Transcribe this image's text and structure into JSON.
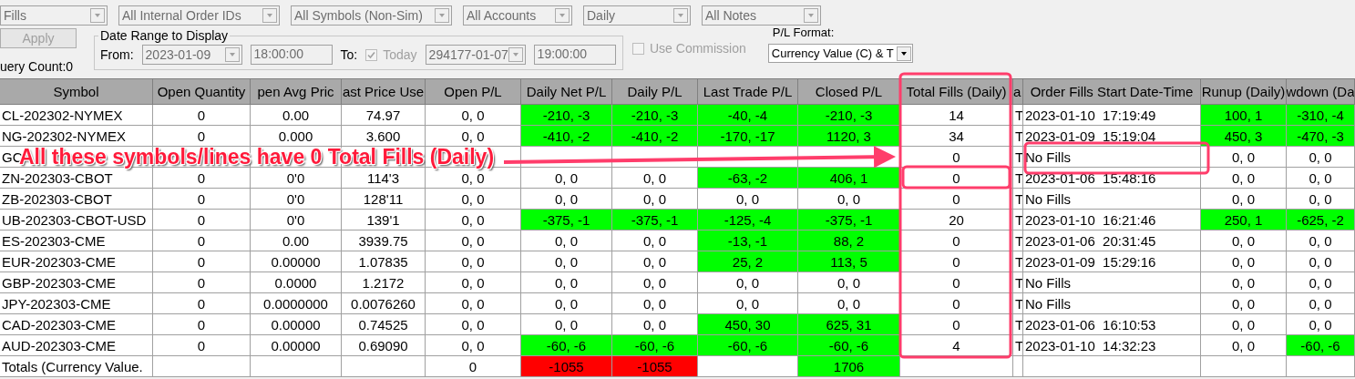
{
  "filters": [
    {
      "value": "Fills",
      "disabled": true
    },
    {
      "value": "All Internal Order IDs",
      "disabled": true
    },
    {
      "value": "All Symbols (Non-Sim)",
      "disabled": true
    },
    {
      "value": "All Accounts",
      "disabled": true
    },
    {
      "value": "Daily",
      "disabled": true
    },
    {
      "value": "All Notes",
      "disabled": true
    }
  ],
  "apply_button": {
    "label": "Apply",
    "disabled": true
  },
  "query_count": "uery Count:0",
  "date_range": {
    "title": "Date Range to Display",
    "from_label": "From:",
    "from_date": "2023-01-09",
    "from_time": "18:00:00",
    "to_label": "To:",
    "today": {
      "label": "Today",
      "checked": true,
      "disabled": true
    },
    "to_date": "294177-01-07",
    "to_time": "19:00:00"
  },
  "use_commission": {
    "label": "Use Commission",
    "checked": false,
    "disabled": true
  },
  "pl_format": {
    "label": "P/L Format:",
    "value": "Currency Value (C) & T"
  },
  "table": {
    "columns": [
      "Symbol",
      "Open Quantity",
      "pen Avg Pric",
      "ast Price Use",
      "Open P/L",
      "Daily Net P/L",
      "Daily P/L",
      "Last Trade P/L",
      "Closed P/L",
      "Total Fills (Daily)",
      "a",
      "Order Fills Start Date-Time",
      "Runup (Daily)",
      "wdown (Da"
    ],
    "rows": [
      [
        {
          "text": "CL-202302-NYMEX"
        },
        {
          "text": "0"
        },
        {
          "text": "0.00"
        },
        {
          "text": "74.97"
        },
        {
          "text": "0, 0"
        },
        {
          "text": "-210, -3",
          "color": "#00ff00"
        },
        {
          "text": "-210, -3",
          "color": "#00ff00"
        },
        {
          "text": "-40, -4",
          "color": "#00ff00"
        },
        {
          "text": "-210, -3",
          "color": "#00ff00"
        },
        {
          "text": "14"
        },
        {
          "text": "T"
        },
        {
          "text": "2023-01-10  17:19:49"
        },
        {
          "text": "100, 1",
          "color": "#00ff00"
        },
        {
          "text": "-310, -4",
          "color": "#00ff00"
        }
      ],
      [
        {
          "text": "NG-202302-NYMEX"
        },
        {
          "text": "0"
        },
        {
          "text": "0.000"
        },
        {
          "text": "3.600"
        },
        {
          "text": "0, 0"
        },
        {
          "text": "-410, -2",
          "color": "#00ff00"
        },
        {
          "text": "-410, -2",
          "color": "#00ff00"
        },
        {
          "text": "-170, -17",
          "color": "#00ff00"
        },
        {
          "text": "1120, 3",
          "color": "#00ff00"
        },
        {
          "text": "34"
        },
        {
          "text": "T"
        },
        {
          "text": "2023-01-09  15:19:04"
        },
        {
          "text": "450, 3",
          "color": "#00ff00"
        },
        {
          "text": "-470, -3",
          "color": "#00ff00"
        }
      ],
      [
        {
          "text": "GC"
        },
        null,
        null,
        null,
        null,
        null,
        null,
        null,
        null,
        {
          "text": "0"
        },
        {
          "text": "T"
        },
        {
          "text": "No Fills"
        },
        {
          "text": "0, 0"
        },
        {
          "text": "0, 0"
        }
      ],
      [
        {
          "text": "ZN-202303-CBOT"
        },
        {
          "text": "0"
        },
        {
          "text": "0'0"
        },
        {
          "text": "114'3"
        },
        {
          "text": "0, 0"
        },
        {
          "text": "0, 0"
        },
        {
          "text": "0, 0"
        },
        {
          "text": "-63, -2",
          "color": "#00ff00"
        },
        {
          "text": "406, 1",
          "color": "#00ff00"
        },
        {
          "text": "0"
        },
        {
          "text": "T"
        },
        {
          "text": "2023-01-06  15:48:16"
        },
        {
          "text": "0, 0"
        },
        {
          "text": "0, 0"
        }
      ],
      [
        {
          "text": "ZB-202303-CBOT"
        },
        {
          "text": "0"
        },
        {
          "text": "0'0"
        },
        {
          "text": "128'11"
        },
        {
          "text": "0, 0"
        },
        {
          "text": "0, 0"
        },
        {
          "text": "0, 0"
        },
        {
          "text": "0, 0"
        },
        {
          "text": "0, 0"
        },
        {
          "text": "0"
        },
        {
          "text": "T"
        },
        {
          "text": "No Fills"
        },
        {
          "text": "0, 0"
        },
        {
          "text": "0, 0"
        }
      ],
      [
        {
          "text": "UB-202303-CBOT-USD"
        },
        {
          "text": "0"
        },
        {
          "text": "0'0"
        },
        {
          "text": "139'1"
        },
        {
          "text": "0, 0"
        },
        {
          "text": "-375, -1",
          "color": "#00ff00"
        },
        {
          "text": "-375, -1",
          "color": "#00ff00"
        },
        {
          "text": "-125, -4",
          "color": "#00ff00"
        },
        {
          "text": "-375, -1",
          "color": "#00ff00"
        },
        {
          "text": "20"
        },
        {
          "text": "T"
        },
        {
          "text": "2023-01-10  16:21:46"
        },
        {
          "text": "250, 1",
          "color": "#00ff00"
        },
        {
          "text": "-625, -2",
          "color": "#00ff00"
        }
      ],
      [
        {
          "text": "ES-202303-CME"
        },
        {
          "text": "0"
        },
        {
          "text": "0.00"
        },
        {
          "text": "3939.75"
        },
        {
          "text": "0, 0"
        },
        {
          "text": "0, 0"
        },
        {
          "text": "0, 0"
        },
        {
          "text": "-13, -1",
          "color": "#00ff00"
        },
        {
          "text": "88, 2",
          "color": "#00ff00"
        },
        {
          "text": "0"
        },
        {
          "text": "T"
        },
        {
          "text": "2023-01-06  20:31:45"
        },
        {
          "text": "0, 0"
        },
        {
          "text": "0, 0"
        }
      ],
      [
        {
          "text": "EUR-202303-CME"
        },
        {
          "text": "0"
        },
        {
          "text": "0.00000"
        },
        {
          "text": "1.07835"
        },
        {
          "text": "0, 0"
        },
        {
          "text": "0, 0"
        },
        {
          "text": "0, 0"
        },
        {
          "text": "25, 2",
          "color": "#00ff00"
        },
        {
          "text": "113, 5",
          "color": "#00ff00"
        },
        {
          "text": "0"
        },
        {
          "text": "T"
        },
        {
          "text": "2023-01-09  15:29:16"
        },
        {
          "text": "0, 0"
        },
        {
          "text": "0, 0"
        }
      ],
      [
        {
          "text": "GBP-202303-CME"
        },
        {
          "text": "0"
        },
        {
          "text": "0.0000"
        },
        {
          "text": "1.2172"
        },
        {
          "text": "0, 0"
        },
        {
          "text": "0, 0"
        },
        {
          "text": "0, 0"
        },
        {
          "text": "0, 0"
        },
        {
          "text": "0, 0"
        },
        {
          "text": "0"
        },
        {
          "text": "T"
        },
        {
          "text": "No Fills"
        },
        {
          "text": "0, 0"
        },
        {
          "text": "0, 0"
        }
      ],
      [
        {
          "text": "JPY-202303-CME"
        },
        {
          "text": "0"
        },
        {
          "text": "0.0000000"
        },
        {
          "text": "0.0076260"
        },
        {
          "text": "0, 0"
        },
        {
          "text": "0, 0"
        },
        {
          "text": "0, 0"
        },
        {
          "text": "0, 0"
        },
        {
          "text": "0, 0"
        },
        {
          "text": "0"
        },
        {
          "text": "T"
        },
        {
          "text": "No Fills"
        },
        {
          "text": "0, 0"
        },
        {
          "text": "0, 0"
        }
      ],
      [
        {
          "text": "CAD-202303-CME"
        },
        {
          "text": "0"
        },
        {
          "text": "0.00000"
        },
        {
          "text": "0.74525"
        },
        {
          "text": "0, 0"
        },
        {
          "text": "0, 0"
        },
        {
          "text": "0, 0"
        },
        {
          "text": "450, 30",
          "color": "#00ff00"
        },
        {
          "text": "625, 31",
          "color": "#00ff00"
        },
        {
          "text": "0"
        },
        {
          "text": "T"
        },
        {
          "text": "2023-01-06  16:10:53"
        },
        {
          "text": "0, 0"
        },
        {
          "text": "0, 0"
        }
      ],
      [
        {
          "text": "AUD-202303-CME"
        },
        {
          "text": "0"
        },
        {
          "text": "0.00000"
        },
        {
          "text": "0.69090"
        },
        {
          "text": "0, 0"
        },
        {
          "text": "-60, -6",
          "color": "#00ff00"
        },
        {
          "text": "-60, -6",
          "color": "#00ff00"
        },
        {
          "text": "-60, -6",
          "color": "#00ff00"
        },
        {
          "text": "-60, -6",
          "color": "#00ff00"
        },
        {
          "text": "4"
        },
        {
          "text": "T"
        },
        {
          "text": "2023-01-10  14:32:23"
        },
        {
          "text": "0, 0"
        },
        {
          "text": "-60, -6",
          "color": "#00ff00"
        }
      ],
      [
        {
          "text": "Totals (Currency Value."
        },
        null,
        null,
        null,
        {
          "text": "0"
        },
        {
          "text": "-1055",
          "color": "#ff0000"
        },
        {
          "text": "-1055",
          "color": "#ff0000"
        },
        null,
        {
          "text": "1706",
          "color": "#00ff00"
        },
        null,
        null,
        null,
        null,
        null
      ]
    ]
  },
  "annotation": {
    "text": "All these symbols/lines have 0 Total Fills (Daily)"
  }
}
